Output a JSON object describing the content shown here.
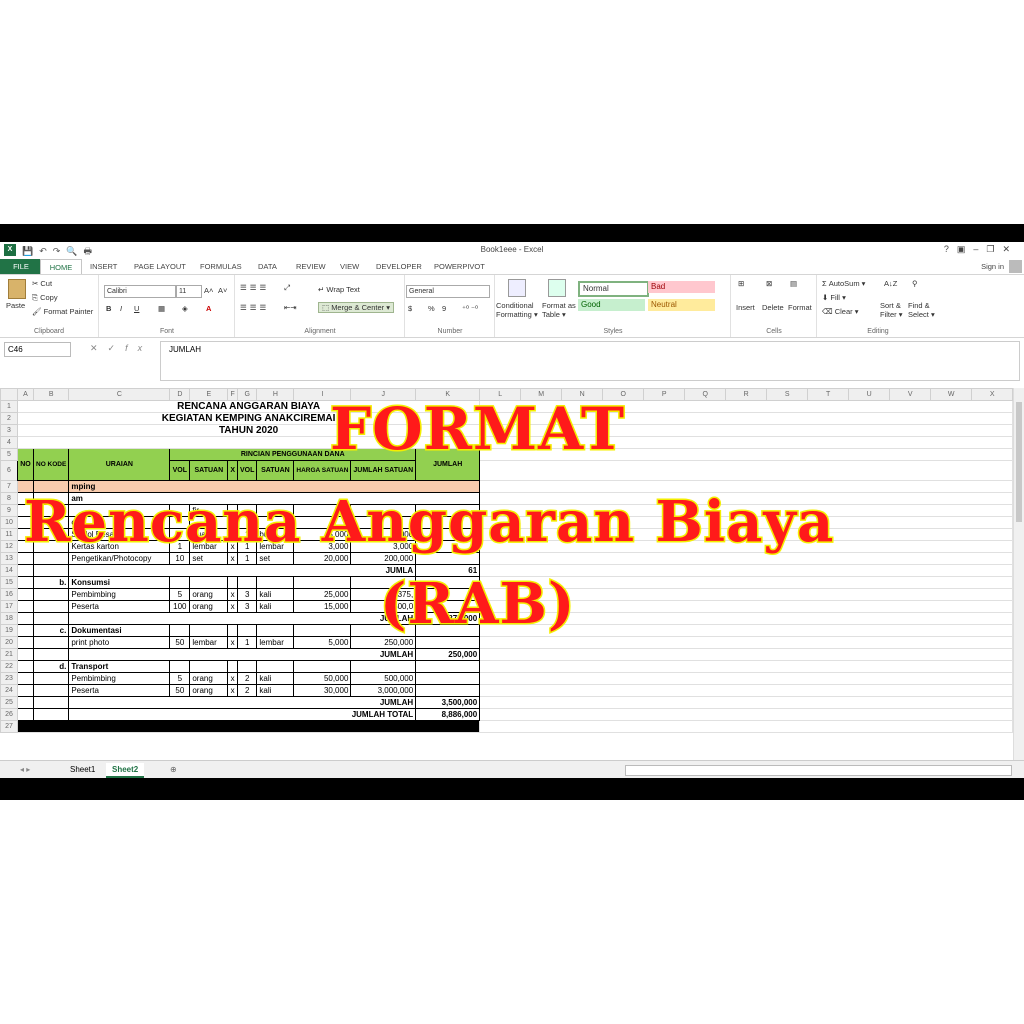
{
  "window": {
    "title": "Book1eee - Excel",
    "app_badge": "X",
    "controls": [
      "?",
      "▣",
      "–",
      "❐",
      "✕"
    ]
  },
  "tabs": [
    "FILE",
    "HOME",
    "INSERT",
    "PAGE LAYOUT",
    "FORMULAS",
    "DATA",
    "REVIEW",
    "VIEW",
    "DEVELOPER",
    "POWERPIVOT"
  ],
  "signin": "Sign in",
  "ribbon": {
    "clipboard": {
      "paste": "Paste",
      "cut": "Cut",
      "copy": "Copy",
      "format_painter": "Format Painter",
      "label": "Clipboard"
    },
    "font": {
      "family": "Calibri",
      "size": "11",
      "label": "Font",
      "grow": "A˄",
      "shrink": "A˅",
      "bold": "B",
      "italic": "I",
      "underline": "U",
      "color": "A"
    },
    "alignment": {
      "wrap": "Wrap Text",
      "merge": "Merge & Center",
      "label": "Alignment"
    },
    "number": {
      "format": "General",
      "currency": "$",
      "percent": "%",
      "comma": "9",
      "label": "Number"
    },
    "styles": {
      "conditional": "Conditional",
      "conditional2": "Formatting",
      "format_table": "Format as",
      "format_table2": "Table",
      "normal": "Normal",
      "bad": "Bad",
      "good": "Good",
      "neutral": "Neutral",
      "label": "Styles"
    },
    "cells": {
      "insert": "Insert",
      "delete": "Delete",
      "format": "Format",
      "label": "Cells"
    },
    "editing": {
      "autosum": "AutoSum",
      "fill": "Fill",
      "clear": "Clear",
      "sort": "Sort &",
      "sort2": "Filter",
      "find": "Find &",
      "find2": "Select",
      "label": "Editing"
    }
  },
  "formula_bar": {
    "name_box": "C46",
    "fx": "fx",
    "content": "JUMLAH"
  },
  "columns": [
    "A",
    "B",
    "C",
    "D",
    "E",
    "F",
    "G",
    "H",
    "I",
    "J",
    "K",
    "L",
    "M",
    "N",
    "O",
    "P",
    "Q",
    "R",
    "S",
    "T",
    "U",
    "V",
    "W",
    "X"
  ],
  "sheet": {
    "title1": "RENCANA ANGGARAN BIAYA",
    "title2": "KEGIATAN KEMPING ANAKCIREMAI",
    "title3": "TAHUN 2020",
    "h_no": "NO",
    "h_nokode": "NO KODE",
    "h_uraian": "URAIAN",
    "h_rincian": "RINCIAN PENGGUNAAN DANA",
    "h_vol": "VOL",
    "h_satuan": "SATUAN",
    "h_x": "X",
    "h_harga": "HARGA SATUAN",
    "h_jumlahsat": "JUMLAH SATUAN",
    "h_jumlah": "JUMLAH",
    "row7": "mping",
    "row8": "am",
    "row9_uraian": "",
    "row9_satuan": "fir",
    "row10": "ool",
    "items": [
      {
        "row": "11",
        "uraian": "Spidol Besar",
        "vol": "1",
        "satuan": "buah",
        "x": "x",
        "vol2": "1",
        "satuan2": "buah",
        "harga": "5,000",
        "jumlah": "5,000"
      },
      {
        "row": "12",
        "uraian": "Kertas karton",
        "vol": "1",
        "satuan": "lembar",
        "x": "x",
        "vol2": "1",
        "satuan2": "lembar",
        "harga": "3,000",
        "jumlah": "3,000"
      },
      {
        "row": "13",
        "uraian": "Pengetikan/Photocopy",
        "vol": "10",
        "satuan": "set",
        "x": "x",
        "vol2": "1",
        "satuan2": "set",
        "harga": "20,000",
        "jumlah": "200,000"
      }
    ],
    "jumlah14": "JUMLA",
    "total14": "61",
    "sec_b": "b.",
    "sec_b_name": "Konsumsi",
    "items_b": [
      {
        "row": "16",
        "uraian": "Pembimbing",
        "vol": "5",
        "satuan": "orang",
        "x": "x",
        "vol2": "3",
        "satuan2": "kali",
        "harga": "25,000",
        "jumlah": "375,"
      },
      {
        "row": "17",
        "uraian": "Peserta",
        "vol": "100",
        "satuan": "orang",
        "x": "x",
        "vol2": "3",
        "satuan2": "kali",
        "harga": "15,000",
        "jumlah": "4,500,0"
      }
    ],
    "jumlah18": "JUMLAH",
    "total18": "4,875,000",
    "sec_c": "c.",
    "sec_c_name": "Dokumentasi",
    "items_c": [
      {
        "row": "20",
        "uraian": "print photo",
        "vol": "50",
        "satuan": "lembar",
        "x": "x",
        "vol2": "1",
        "satuan2": "lembar",
        "harga": "5,000",
        "jumlah": "250,000"
      }
    ],
    "jumlah21": "JUMLAH",
    "total21": "250,000",
    "sec_d": "d.",
    "sec_d_name": "Transport",
    "items_d": [
      {
        "row": "23",
        "uraian": "Pembimbing",
        "vol": "5",
        "satuan": "orang",
        "x": "x",
        "vol2": "2",
        "satuan2": "kali",
        "harga": "50,000",
        "jumlah": "500,000"
      },
      {
        "row": "24",
        "uraian": "Peserta",
        "vol": "50",
        "satuan": "orang",
        "x": "x",
        "vol2": "2",
        "satuan2": "kali",
        "harga": "30,000",
        "jumlah": "3,000,000"
      }
    ],
    "jumlah25": "JUMLAH",
    "total25": "3,500,000",
    "jumlahtotal": "JUMLAH TOTAL",
    "grandtotal": "8,886,000"
  },
  "sheet_tabs": [
    "Sheet1",
    "Sheet2"
  ],
  "overlay": {
    "line1": "FORMAT",
    "line2": "Rencana Anggaran Biaya",
    "line3": "(RAB)"
  }
}
